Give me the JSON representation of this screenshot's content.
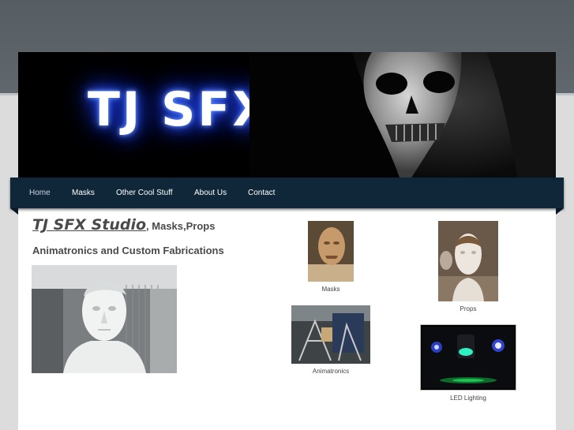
{
  "banner": {
    "logo_text": "TJ SFX"
  },
  "nav": {
    "items": [
      {
        "label": "Home"
      },
      {
        "label": "Masks"
      },
      {
        "label": "Other Cool Stuff"
      },
      {
        "label": "About Us"
      },
      {
        "label": "Contact"
      }
    ]
  },
  "content": {
    "title_link": "TJ SFX Studio",
    "title_rest": ", Masks,Props",
    "subtitle": "Animatronics and Custom Fabrications"
  },
  "gallery": [
    {
      "caption": "Masks"
    },
    {
      "caption": "Props"
    },
    {
      "caption": "Animatronics"
    },
    {
      "caption": "LED Lighting"
    }
  ],
  "colors": {
    "nav_bg": "#0f2739",
    "header_band": "#5b6268",
    "text": "#4a4a4a"
  }
}
